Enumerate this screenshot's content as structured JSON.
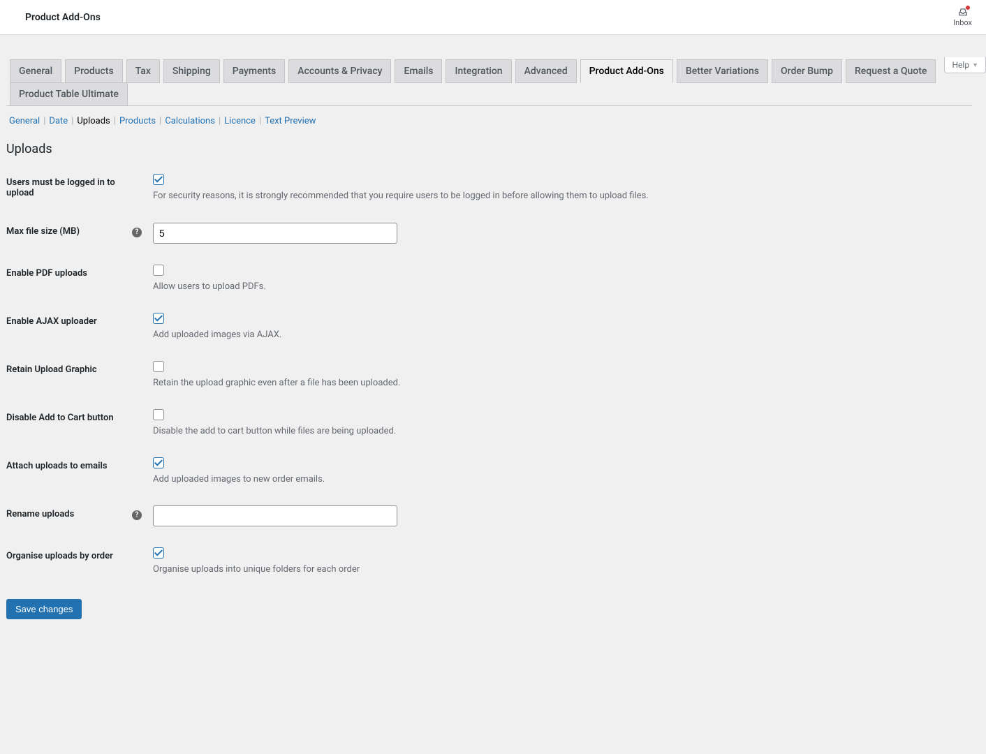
{
  "header": {
    "title": "Product Add-Ons",
    "inbox_label": "Inbox"
  },
  "help": {
    "label": "Help"
  },
  "tabs": [
    {
      "label": "General"
    },
    {
      "label": "Products"
    },
    {
      "label": "Tax"
    },
    {
      "label": "Shipping"
    },
    {
      "label": "Payments"
    },
    {
      "label": "Accounts & Privacy"
    },
    {
      "label": "Emails"
    },
    {
      "label": "Integration"
    },
    {
      "label": "Advanced"
    },
    {
      "label": "Product Add-Ons",
      "active": true
    },
    {
      "label": "Better Variations"
    },
    {
      "label": "Order Bump"
    },
    {
      "label": "Request a Quote"
    },
    {
      "label": "Product Table Ultimate"
    }
  ],
  "subtabs": [
    {
      "label": "General"
    },
    {
      "label": "Date"
    },
    {
      "label": "Uploads",
      "current": true
    },
    {
      "label": "Products"
    },
    {
      "label": "Calculations"
    },
    {
      "label": "Licence"
    },
    {
      "label": "Text Preview"
    }
  ],
  "section": {
    "title": "Uploads"
  },
  "fields": {
    "logged_in": {
      "label": "Users must be logged in to upload",
      "checked": true,
      "desc": "For security reasons, it is strongly recommended that you require users to be logged in before allowing them to upload files."
    },
    "max_size": {
      "label": "Max file size (MB)",
      "value": "5",
      "tip": true
    },
    "pdf": {
      "label": "Enable PDF uploads",
      "checked": false,
      "desc": "Allow users to upload PDFs."
    },
    "ajax": {
      "label": "Enable AJAX uploader",
      "checked": true,
      "desc": "Add uploaded images via AJAX."
    },
    "retain": {
      "label": "Retain Upload Graphic",
      "checked": false,
      "desc": "Retain the upload graphic even after a file has been uploaded."
    },
    "disable_cart": {
      "label": "Disable Add to Cart button",
      "checked": false,
      "desc": "Disable the add to cart button while files are being uploaded."
    },
    "attach": {
      "label": "Attach uploads to emails",
      "checked": true,
      "desc": "Add uploaded images to new order emails."
    },
    "rename": {
      "label": "Rename uploads",
      "value": "",
      "tip": true
    },
    "organise": {
      "label": "Organise uploads by order",
      "checked": true,
      "desc": "Organise uploads into unique folders for each order"
    }
  },
  "submit": {
    "label": "Save changes"
  }
}
